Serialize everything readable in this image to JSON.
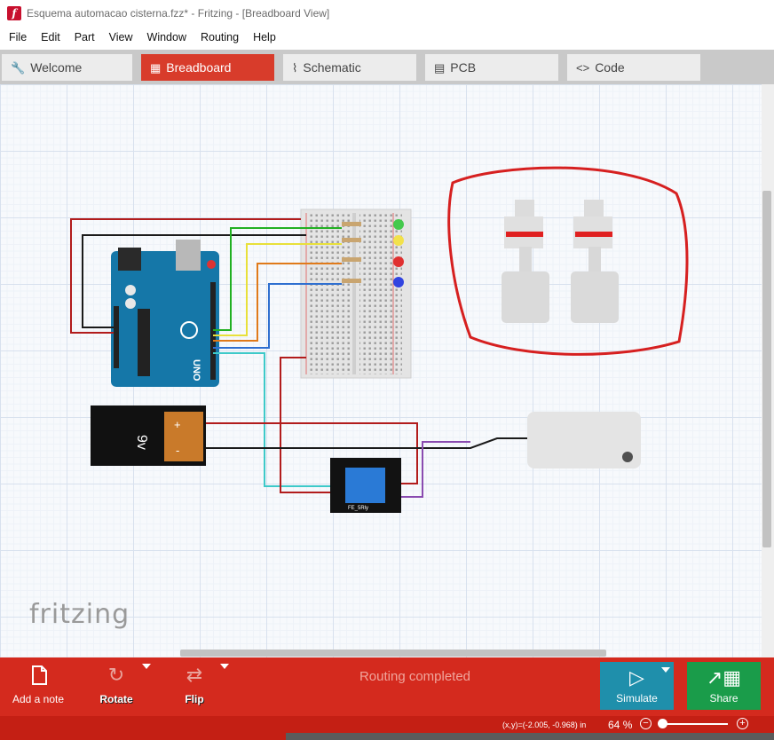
{
  "window": {
    "title": "Esquema automacao cisterna.fzz* - Fritzing - [Breadboard View]",
    "app_icon_letter": "f"
  },
  "menu": [
    "File",
    "Edit",
    "Part",
    "View",
    "Window",
    "Routing",
    "Help"
  ],
  "tabs": [
    {
      "label": "Welcome",
      "icon": "🔧",
      "active": false
    },
    {
      "label": "Breadboard",
      "icon": "▦",
      "active": true
    },
    {
      "label": "Schematic",
      "icon": "⌇",
      "active": false
    },
    {
      "label": "PCB",
      "icon": "▤",
      "active": false
    },
    {
      "label": "Code",
      "icon": "<>",
      "active": false
    }
  ],
  "canvas": {
    "watermark": "fritzing",
    "battery_label": "9v",
    "battery_plus": "+",
    "battery_minus": "-",
    "board_label": "UNO",
    "relay_label": "FE_5Rly"
  },
  "toolbar": {
    "add_note": "Add a note",
    "rotate": "Rotate",
    "flip": "Flip",
    "status": "Routing completed",
    "simulate": "Simulate",
    "share": "Share"
  },
  "statusbar": {
    "coords": "(x,y)=(-2.005, -0.968) in",
    "zoom_value": "64",
    "zoom_unit": "%"
  },
  "colors": {
    "accent": "#d42a1e",
    "simulate": "#1f8fab",
    "share": "#1a9c4a"
  }
}
